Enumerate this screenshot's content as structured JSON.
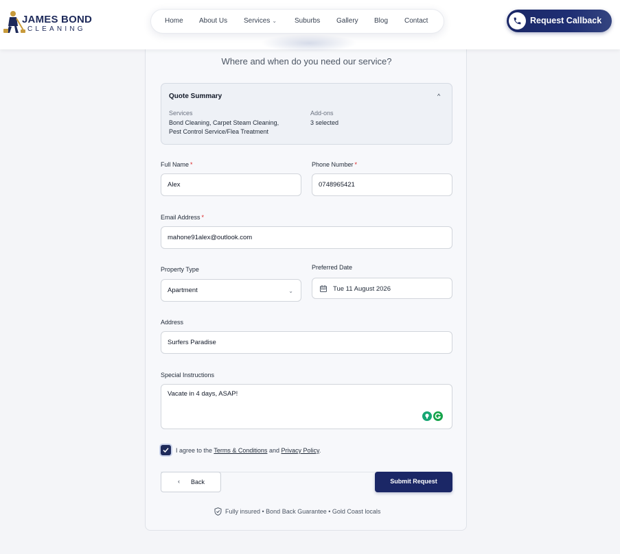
{
  "brand": {
    "name_top": "JAMES BOND",
    "name_bottom": "CLEANING"
  },
  "nav": {
    "items": [
      "Home",
      "About Us",
      "Services",
      "Suburbs",
      "Gallery",
      "Blog",
      "Contact"
    ]
  },
  "header": {
    "callback_label": "Request Callback"
  },
  "form": {
    "heading": "Where and when do you need our service?",
    "quote_summary": {
      "title": "Quote Summary",
      "services_label": "Services",
      "services_value_line1": "Bond Cleaning, Carpet Steam Cleaning,",
      "services_value_line2": "Pest Control Service/Flea Treatment",
      "addons_label": "Add-ons",
      "addons_value": "3 selected"
    },
    "full_name": {
      "label": "Full Name",
      "value": "Alex"
    },
    "phone": {
      "label": "Phone Number",
      "value": "0748965421"
    },
    "email": {
      "label": "Email Address",
      "value": "mahone91alex@outlook.com"
    },
    "property_type": {
      "label": "Property Type",
      "value": "Apartment"
    },
    "preferred_date": {
      "label": "Preferred Date",
      "value": "Tue 11 August 2026"
    },
    "address": {
      "label": "Address",
      "value": "Surfers Paradise"
    },
    "special_instructions": {
      "label": "Special Instructions",
      "value": "Vacate in 4 days, ASAP!"
    },
    "required_marker": "*",
    "agree": {
      "prefix": "I agree to the",
      "terms_link": "Terms & Conditions",
      "and": "and",
      "privacy_link": "Privacy Policy",
      "suffix": "."
    },
    "back_label": "Back",
    "submit_label": "Submit Request",
    "trust_text": "Fully insured • Bond Back Guarantee • Gold Coast locals"
  },
  "colors": {
    "brand_navy": "#1b2766",
    "required_red": "#dc2626",
    "page_bg": "#f4f5f8"
  }
}
